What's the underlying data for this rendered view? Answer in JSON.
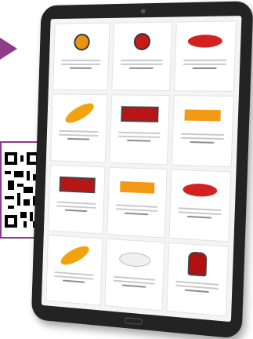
{
  "colors": {
    "accent": "#8d3b8a",
    "tablet_frame": "#232323",
    "screen_background": "#f4f4f4"
  },
  "screen": {
    "products": [
      {
        "thumb": "round-amber"
      },
      {
        "thumb": "round-red"
      },
      {
        "thumb": "oval-red"
      },
      {
        "thumb": "oval-amber"
      },
      {
        "thumb": "rect-red"
      },
      {
        "thumb": "rect-amber"
      },
      {
        "thumb": "rect-red"
      },
      {
        "thumb": "rect-amber"
      },
      {
        "thumb": "oval-red"
      },
      {
        "thumb": "oval-amber"
      },
      {
        "thumb": "oval-white"
      },
      {
        "thumb": "cap-red"
      }
    ]
  }
}
